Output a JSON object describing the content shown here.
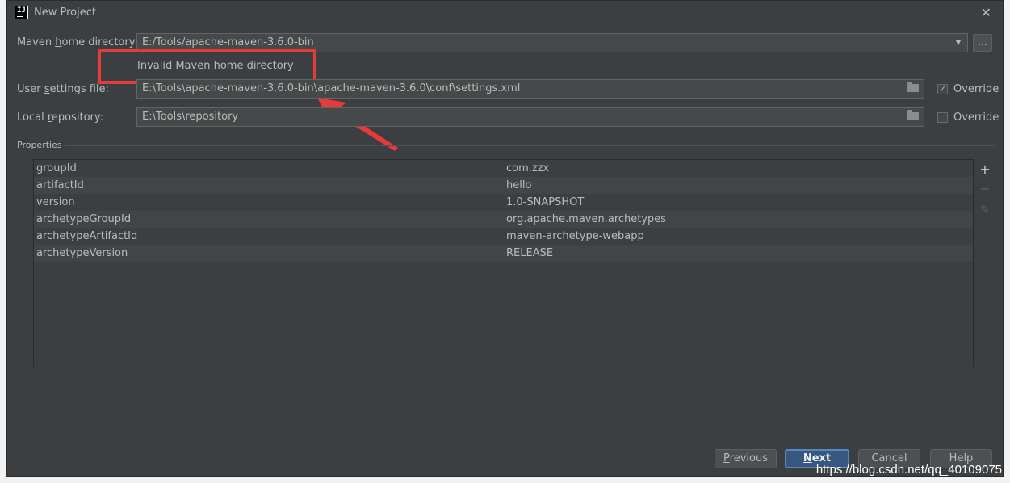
{
  "window": {
    "title": "New Project"
  },
  "maven": {
    "home_label_pre": "Maven ",
    "home_label_mn": "h",
    "home_label_post": "ome directory:",
    "home_value": "E:/Tools/apache-maven-3.6.0-bin",
    "browse_label": "...",
    "invalid_message": "Invalid Maven home directory",
    "settings_label_pre": "User ",
    "settings_label_mn": "s",
    "settings_label_post": "ettings file:",
    "settings_value": "E:\\Tools\\apache-maven-3.6.0-bin\\apache-maven-3.6.0\\conf\\settings.xml",
    "settings_override_label": "Override",
    "settings_override_checked": true,
    "repo_label_pre": "Local ",
    "repo_label_mn": "r",
    "repo_label_post": "epository:",
    "repo_value": "E:\\Tools\\repository",
    "repo_override_label": "Override",
    "repo_override_checked": false
  },
  "properties": {
    "section_label": "Properties",
    "rows": [
      {
        "key": "groupId",
        "value": "com.zzx"
      },
      {
        "key": "artifactId",
        "value": "hello"
      },
      {
        "key": "version",
        "value": "1.0-SNAPSHOT"
      },
      {
        "key": "archetypeGroupId",
        "value": "org.apache.maven.archetypes"
      },
      {
        "key": "archetypeArtifactId",
        "value": "maven-archetype-webapp"
      },
      {
        "key": "archetypeVersion",
        "value": "RELEASE"
      }
    ]
  },
  "buttons": {
    "previous_mn": "P",
    "previous_rest": "revious",
    "next_mn": "N",
    "next_rest": "ext",
    "cancel": "Cancel",
    "help": "Help"
  },
  "watermark": "https://blog.csdn.net/qq_40109075",
  "colors": {
    "dialog_bg": "#3c3f41",
    "highlight_red": "#e83a3a",
    "primary_button": "#365880"
  }
}
